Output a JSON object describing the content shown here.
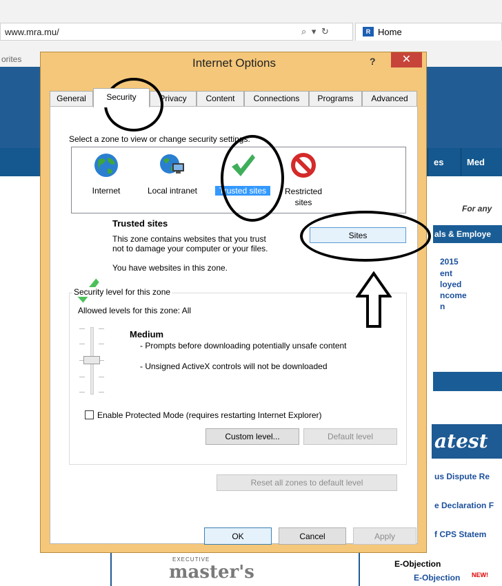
{
  "browser": {
    "url": "www.mra.mu/",
    "tab_title": "Home",
    "favorites_label": "orites"
  },
  "website": {
    "nav_items": [
      "es",
      "Med"
    ],
    "subtitle": "For any",
    "bar_text": "als & Employe",
    "links": [
      "2015",
      "ent",
      "loyed",
      "ncome",
      "n"
    ],
    "latest_heading": "atest",
    "latest_items": [
      "us Dispute Re",
      "e Declaration F",
      "f CPS Statem"
    ],
    "eobjection_heading": "E-Objection",
    "eobjection_link": "E-Objection",
    "new_badge": "NEW!",
    "logo_small": "EXECUTIVE",
    "logo_text": "master's"
  },
  "dialog": {
    "title": "Internet Options",
    "help_label": "?",
    "close_label": "✕",
    "tabs": [
      {
        "label": "General",
        "active": false
      },
      {
        "label": "Security",
        "active": true
      },
      {
        "label": "Privacy",
        "active": false
      },
      {
        "label": "Content",
        "active": false
      },
      {
        "label": "Connections",
        "active": false
      },
      {
        "label": "Programs",
        "active": false
      },
      {
        "label": "Advanced",
        "active": false
      }
    ],
    "zone_prompt": "Select a zone to view or change security settings.",
    "zones": [
      {
        "label": "Internet",
        "icon": "globe-icon"
      },
      {
        "label": "Local intranet",
        "icon": "intranet-icon"
      },
      {
        "label": "Trusted sites",
        "icon": "checkmark-icon",
        "selected": true
      },
      {
        "label": "Restricted sites",
        "icon": "restricted-icon"
      }
    ],
    "selected_zone": {
      "name": "Trusted sites",
      "desc1": "This zone contains websites that you trust not to damage your computer or your files.",
      "desc2": "You have websites in this zone.",
      "sites_button": "Sites"
    },
    "security_level": {
      "group_label": "Security level for this zone",
      "allowed": "Allowed levels for this zone: All",
      "level_name": "Medium",
      "bullet1": "- Prompts before downloading potentially unsafe content",
      "bullet2": "- Unsigned ActiveX controls will not be downloaded",
      "protected_mode_label": "Enable Protected Mode (requires restarting Internet Explorer)",
      "protected_mode_checked": false,
      "custom_level": "Custom level...",
      "default_level": "Default level"
    },
    "reset_all": "Reset all zones to default level",
    "ok": "OK",
    "cancel": "Cancel",
    "apply": "Apply"
  },
  "colors": {
    "dialog_frame": "#f4c77a",
    "close_button": "#c7443a",
    "site_blue": "#215d94",
    "selection": "#3399ff"
  }
}
